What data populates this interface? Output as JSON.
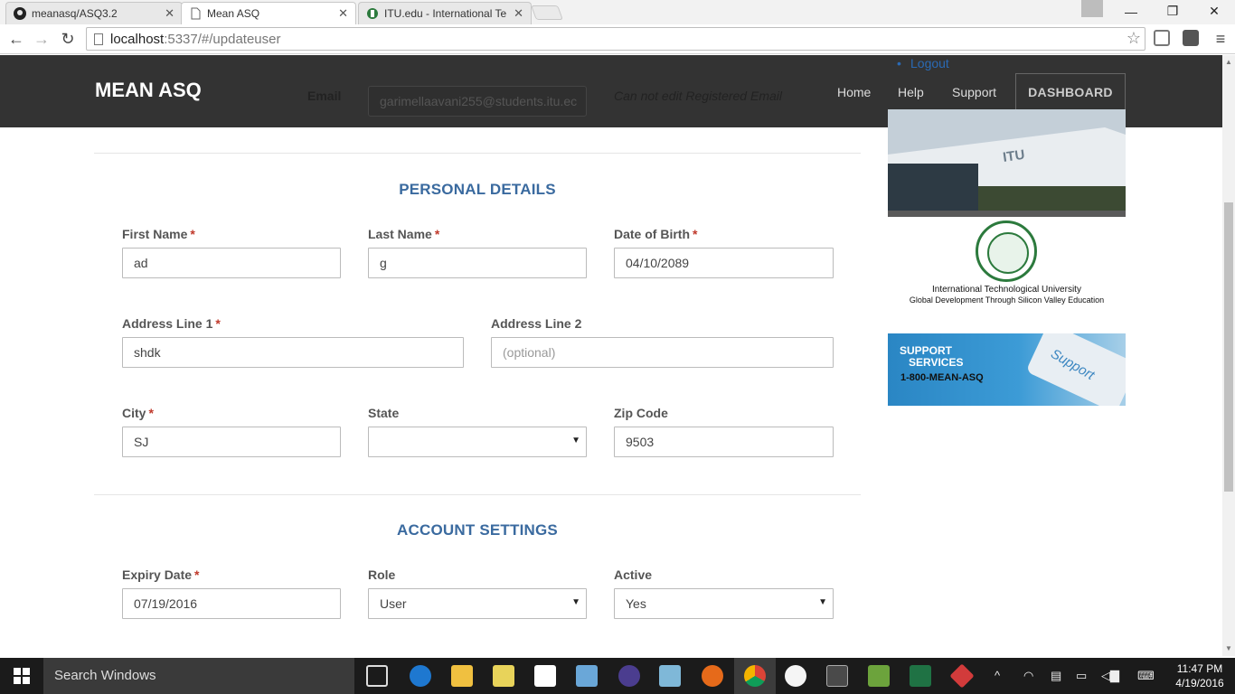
{
  "browser": {
    "tabs": [
      {
        "title": "meanasq/ASQ3.2",
        "active": false
      },
      {
        "title": "Mean ASQ",
        "active": true
      },
      {
        "title": "ITU.edu - International Te",
        "active": false
      }
    ],
    "url_host": "localhost",
    "url_path": ":5337/#/updateuser"
  },
  "navbar": {
    "brand": "MEAN ASQ",
    "email_label": "Email",
    "email_value": "garimellaavani255@students.itu.ec",
    "email_note": "Can not edit Registered Email",
    "links": [
      "Home",
      "Help",
      "Support"
    ],
    "logout": "Logout",
    "dashboard": "DASHBOARD"
  },
  "personal": {
    "title": "PERSONAL DETAILS",
    "first_name_label": "First Name",
    "first_name": "ad",
    "last_name_label": "Last Name",
    "last_name": "g",
    "dob_label": "Date of Birth",
    "dob": "04/10/2089",
    "address1_label": "Address Line 1",
    "address1": "shdk",
    "address2_label": "Address Line 2",
    "address2_placeholder": "(optional)",
    "city_label": "City",
    "city": "SJ",
    "state_label": "State",
    "state": "",
    "zip_label": "Zip Code",
    "zip": "9503",
    "required_mark": "*"
  },
  "account": {
    "title": "ACCOUNT SETTINGS",
    "expiry_label": "Expiry Date",
    "expiry": "07/19/2016",
    "role_label": "Role",
    "role": "User",
    "active_label": "Active",
    "active": "Yes"
  },
  "sidebar": {
    "photo_sign": "ITU",
    "university_name": "International Technological University",
    "university_tagline": "Global Development Through Silicon Valley Education",
    "support_title_1": "SUPPORT",
    "support_title_2": "SERVICES",
    "support_phone": "1-800-MEAN-ASQ",
    "support_key": "Support"
  },
  "taskbar": {
    "search_placeholder": "Search Windows",
    "time": "11:47 PM",
    "date": "4/19/2016"
  },
  "colors": {
    "navbar_bg": "#333333",
    "section_title": "#3a6a9f",
    "required": "#c0392b",
    "link": "#2a6ab5"
  }
}
